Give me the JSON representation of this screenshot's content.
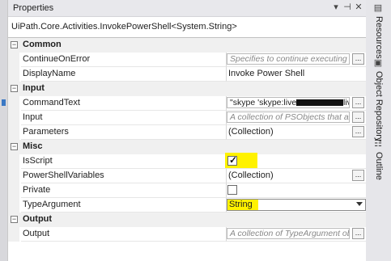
{
  "panel": {
    "title": "Properties",
    "pin_glyph": "⊣",
    "close_glyph": "✕",
    "dropdown_glyph": "▾",
    "activity_type": "UiPath.Core.Activities.InvokePowerShell<System.String>"
  },
  "categories": {
    "common": "Common",
    "input": "Input",
    "misc": "Misc",
    "output": "Output"
  },
  "collapse_glyph": "−",
  "ellipsis_label": "...",
  "properties": {
    "continue_on_error": {
      "name": "ContinueOnError",
      "placeholder": "Specifies to continue executing the"
    },
    "display_name": {
      "name": "DisplayName",
      "value": "Invoke Power Shell"
    },
    "command_text": {
      "name": "CommandText",
      "value": "\"skype 'skype:live:",
      "value_tail": "liv"
    },
    "input": {
      "name": "Input",
      "placeholder": "A collection of PSObjects that are p"
    },
    "parameters": {
      "name": "Parameters",
      "value": "(Collection)"
    },
    "is_script": {
      "name": "IsScript",
      "checked": true
    },
    "powershell_variables": {
      "name": "PowerShellVariables",
      "value": "(Collection)"
    },
    "private": {
      "name": "Private",
      "checked": false
    },
    "type_argument": {
      "name": "TypeArgument",
      "value": "String"
    },
    "output": {
      "name": "Output",
      "placeholder": "A collection of TypeArgument objec"
    }
  },
  "right_rail": {
    "tabs": [
      {
        "label": "Resources",
        "icon": "resources-icon"
      },
      {
        "label": "Object Repository",
        "icon": "object-repository-icon"
      },
      {
        "label": "Outline",
        "icon": "outline-icon"
      }
    ]
  },
  "colors": {
    "highlight": "#fff200",
    "category_bg": "#f0f0f0"
  }
}
